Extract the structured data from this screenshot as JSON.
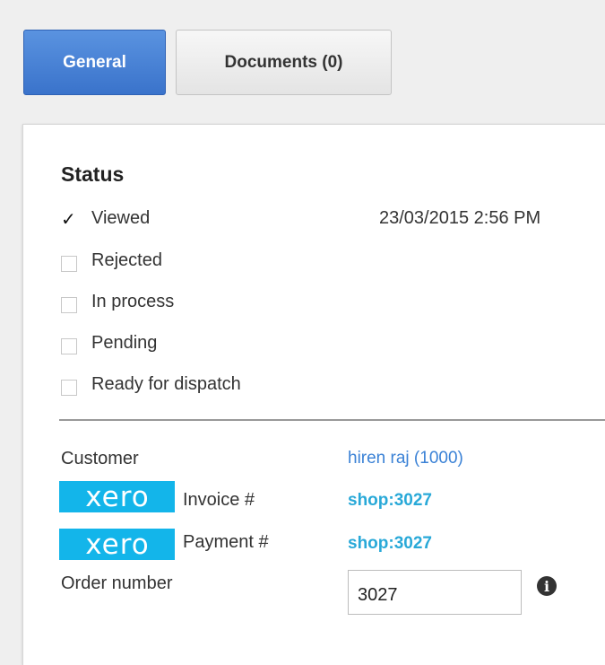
{
  "tabs": {
    "general": "General",
    "documents": "Documents (0)"
  },
  "status": {
    "title": "Status",
    "items": [
      {
        "label": "Viewed",
        "checked": true,
        "timestamp": "23/03/2015 2:56 PM"
      },
      {
        "label": "Rejected",
        "checked": false
      },
      {
        "label": "In process",
        "checked": false
      },
      {
        "label": "Pending",
        "checked": false
      },
      {
        "label": "Ready for dispatch",
        "checked": false
      }
    ]
  },
  "details": {
    "customer_label": "Customer",
    "customer_value": "hiren raj (1000)",
    "xero_logo": "xero",
    "invoice_label": "Invoice #",
    "invoice_value": "shop:3027",
    "payment_label": "Payment #",
    "payment_value": "shop:3027",
    "order_label": "Order number",
    "order_value": "3027",
    "info_icon": "info-icon"
  },
  "colors": {
    "primary_tab": "#3a73cb",
    "xero_brand": "#13b5ea",
    "link": "#3b82d6"
  }
}
